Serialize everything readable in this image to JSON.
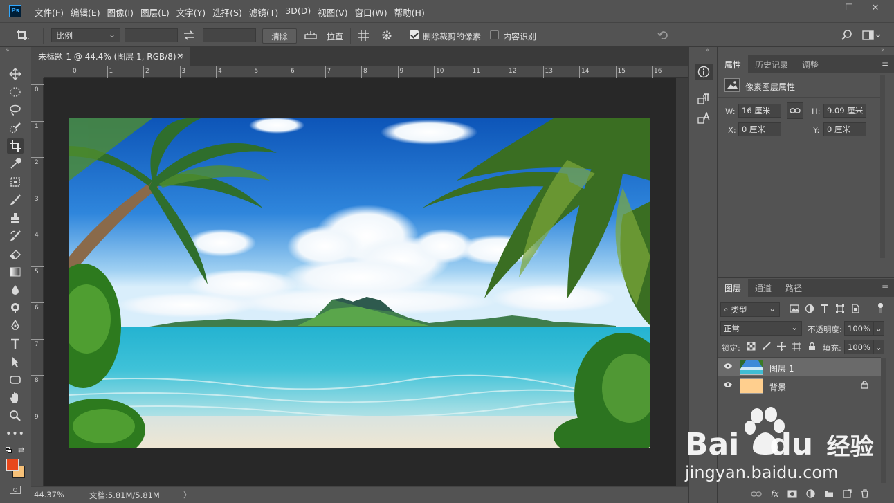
{
  "app": {
    "logo": "Ps"
  },
  "menu": [
    "文件(F)",
    "编辑(E)",
    "图像(I)",
    "图层(L)",
    "文字(Y)",
    "选择(S)",
    "滤镜(T)",
    "3D(D)",
    "视图(V)",
    "窗口(W)",
    "帮助(H)"
  ],
  "window_controls": {
    "minimize": "—",
    "maximize": "☐",
    "close": "✕"
  },
  "options": {
    "ratio_select": "比例",
    "width_value": "",
    "height_value": "",
    "clear_button": "清除",
    "straighten_label": "拉直",
    "delete_cropped": "删除裁剪的像素",
    "delete_cropped_checked": true,
    "content_aware": "内容识别",
    "content_aware_checked": false
  },
  "document": {
    "tab_title": "未标题-1 @ 44.4% (图层 1, RGB/8) *",
    "tab_close": "×",
    "ruler_top": [
      "0",
      "1",
      "2",
      "3",
      "4",
      "5",
      "6",
      "7",
      "8",
      "9",
      "10",
      "11",
      "12",
      "13",
      "14",
      "15",
      "16"
    ],
    "ruler_left": [
      "0",
      "1",
      "2",
      "3",
      "4",
      "5",
      "6",
      "7",
      "8",
      "9"
    ],
    "zoom": "44.37%",
    "doc_info": "文档:5.81M/5.81M",
    "status_arrow": "〉"
  },
  "properties_panel": {
    "tabs": [
      "属性",
      "历史记录",
      "调整"
    ],
    "active_tab": 0,
    "section_title": "像素图层属性",
    "w_label": "W:",
    "w_value": "16 厘米",
    "h_label": "H:",
    "h_value": "9.09 厘米",
    "x_label": "X:",
    "x_value": "0 厘米",
    "y_label": "Y:",
    "y_value": "0 厘米"
  },
  "layers_panel": {
    "tabs": [
      "图层",
      "通道",
      "路径"
    ],
    "active_tab": 0,
    "filter_kind": "类型",
    "blend_mode": "正常",
    "opacity_label": "不透明度:",
    "opacity_value": "100%",
    "lock_label": "锁定:",
    "fill_label": "填充:",
    "fill_value": "100%",
    "layers": [
      {
        "name": "图层 1",
        "selected": true,
        "visible": true,
        "locked": false
      },
      {
        "name": "背景",
        "selected": false,
        "visible": true,
        "locked": true
      }
    ]
  },
  "watermark": {
    "brand": "Bai",
    "brand2": "du",
    "cn": "经验",
    "url": "jingyan.baidu.com"
  },
  "colors": {
    "foreground": "#e8481c",
    "background": "#f7c178",
    "bg_layer_swatch": "#ffcf8e",
    "accent": "#31a8ff"
  }
}
